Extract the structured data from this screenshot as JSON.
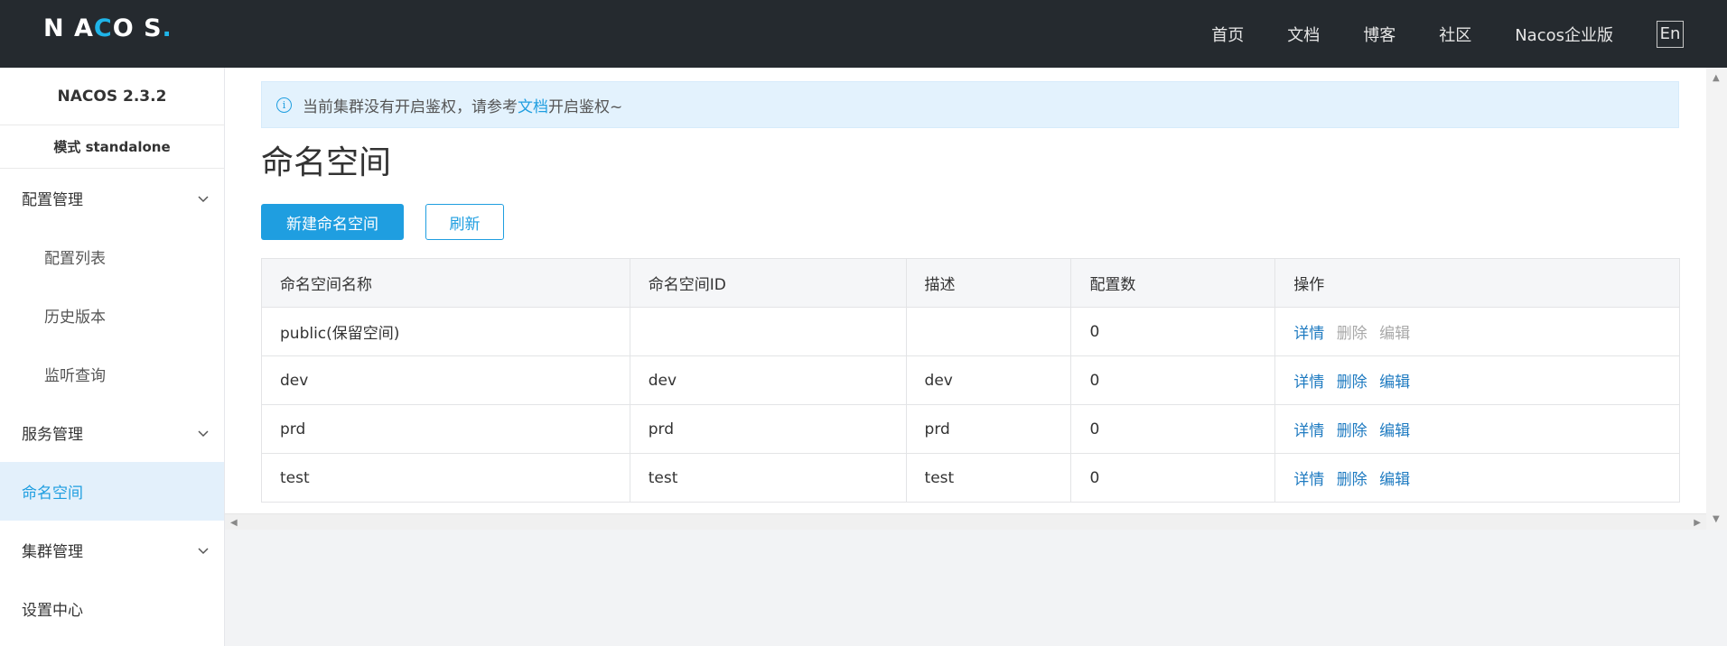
{
  "header": {
    "logo_main": "NACOS",
    "nav": [
      "首页",
      "文档",
      "博客",
      "社区",
      "Nacos企业版"
    ],
    "lang": "En"
  },
  "sidebar": {
    "version": "NACOS 2.3.2",
    "mode": "模式 standalone",
    "groups": [
      {
        "label": "配置管理",
        "expanded": true,
        "items": [
          "配置列表",
          "历史版本",
          "监听查询"
        ]
      },
      {
        "label": "服务管理",
        "expanded": false
      },
      {
        "label": "命名空间",
        "active": true
      },
      {
        "label": "集群管理",
        "expanded": false
      },
      {
        "label": "设置中心"
      }
    ]
  },
  "notice": {
    "text_before": "当前集群没有开启鉴权，请参考",
    "link": "文档",
    "text_after": "开启鉴权~"
  },
  "page": {
    "title": "命名空间",
    "new_button": "新建命名空间",
    "refresh_button": "刷新"
  },
  "table": {
    "columns": [
      "命名空间名称",
      "命名空间ID",
      "描述",
      "配置数",
      "操作"
    ],
    "rows": [
      {
        "name": "public(保留空间)",
        "id": "",
        "desc": "",
        "count": "0",
        "ops": [
          "详情",
          "删除",
          "编辑"
        ],
        "ops_disabled": [
          false,
          true,
          true
        ]
      },
      {
        "name": "dev",
        "id": "dev",
        "desc": "dev",
        "count": "0",
        "ops": [
          "详情",
          "删除",
          "编辑"
        ],
        "ops_disabled": [
          false,
          false,
          false
        ]
      },
      {
        "name": "prd",
        "id": "prd",
        "desc": "prd",
        "count": "0",
        "ops": [
          "详情",
          "删除",
          "编辑"
        ],
        "ops_disabled": [
          false,
          false,
          false
        ]
      },
      {
        "name": "test",
        "id": "test",
        "desc": "test",
        "count": "0",
        "ops": [
          "详情",
          "删除",
          "编辑"
        ],
        "ops_disabled": [
          false,
          false,
          false
        ]
      }
    ]
  },
  "colors": {
    "accent": "#1f9ee0",
    "header_bg": "#252a2f",
    "link": "#1f7bc1"
  }
}
